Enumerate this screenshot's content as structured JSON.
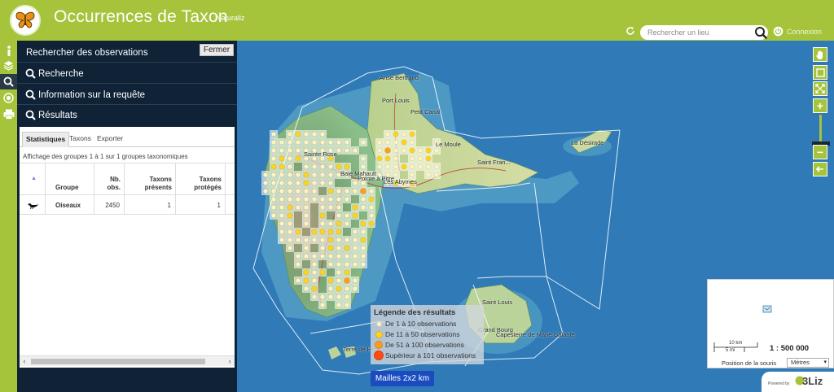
{
  "header": {
    "title": "Occurrences de Taxon",
    "subtitle": "Naturaliz",
    "search_placeholder": "Rechercher un lieu",
    "login": "Connexion",
    "logo_icon": "butterfly-icon"
  },
  "dock": {
    "items": [
      "info-icon",
      "layers-icon",
      "search-icon",
      "locate-icon",
      "print-icon"
    ],
    "active": "search-icon"
  },
  "panel": {
    "title": "Rechercher des observations",
    "close_label": "Fermer",
    "sections": [
      "Recherche",
      "Information sur la requête",
      "Résultats"
    ],
    "tabs": [
      "Statistiques",
      "Taxons",
      "Exporter"
    ],
    "active_tab": "Statistiques",
    "info": "Affichage des groupes 1 à 1 sur 1 groupes taxonomiques",
    "columns": {
      "group": "Groupe",
      "obs_1": "Nb.",
      "obs_2": "obs.",
      "present_1": "Taxons",
      "present_2": "présents",
      "protected_1": "Taxons",
      "protected_2": "protégés"
    },
    "rows": [
      {
        "group": "Oiseaux",
        "obs": "2450",
        "present": "1",
        "protected": "1",
        "icon": "bird-icon"
      }
    ]
  },
  "map": {
    "labels": [
      "Anse Bertrand",
      "Port Louis",
      "Petit Canal",
      "Le Moule",
      "Saint Fran...",
      "La Désirade",
      "Sainte Rose",
      "Baie Mahault",
      "Pointe à Pitre",
      "Les Abymes",
      "Saint Louis",
      "Grand Bourg",
      "Capesterre de Marie Galante",
      "Terre de Haut"
    ]
  },
  "legend": {
    "title": "Légende des résultats",
    "items": [
      {
        "label": "De 1 à 10 observations",
        "color": "#fff3c4"
      },
      {
        "label": "De 11 à 50 observations",
        "color": "#ffd21f"
      },
      {
        "label": "De 51 à 100 observations",
        "color": "#ff9d1a"
      },
      {
        "label": "Supérieur à 101 observations",
        "color": "#ff4a12"
      }
    ]
  },
  "mesh_button": "Mailles 2x2 km",
  "scale": {
    "km": "10 km",
    "mi": "5 mi",
    "value": "1 : 500 000",
    "mouse_label": "Position de la souris",
    "unit": "Mètres"
  },
  "powered": {
    "by": "Powered by",
    "brand": "3Liz"
  },
  "colors": {
    "brand": "#a5c43b",
    "panel": "#0f2236",
    "sea": "#2f7ab7"
  }
}
